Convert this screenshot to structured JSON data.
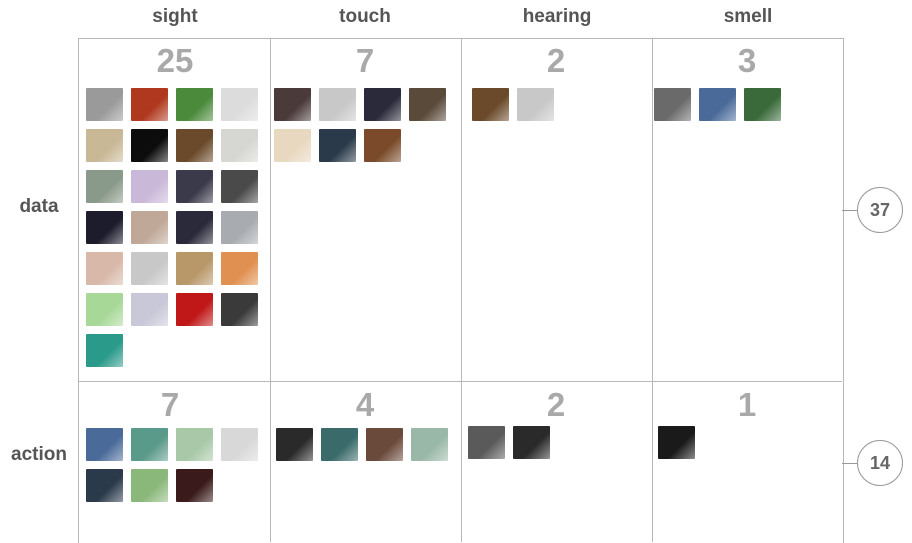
{
  "columns": [
    "sight",
    "touch",
    "hearing",
    "smell"
  ],
  "rows": [
    {
      "label": "data",
      "total": "37",
      "cells": [
        {
          "count": "25",
          "thumbs": [
            "#9a9a9a",
            "#b0381e",
            "#4a8a3a",
            "#dcdcdc",
            "#c9b896",
            "#0c0c0c",
            "#6a4a2a",
            "#d6d6d2",
            "#8a9a8a",
            "#c9b8d8",
            "#3a3a4a",
            "#4a4a4a",
            "#1c1c2c",
            "#c0a898",
            "#2a2a3a",
            "#a8acb0",
            "#d8b8a8",
            "#c8c8c8",
            "#b89868",
            "#e09050",
            "#a8d898",
            "#c8c8d8",
            "#c01818",
            "#3a3a3a",
            "#2a9a8a"
          ]
        },
        {
          "count": "7",
          "thumbs": [
            "#4a3a3a",
            "#c8c8c8",
            "#2a2a3a",
            "#5a4a3a",
            "#e8d8c0",
            "#2a3a4a",
            "#7a4a2a"
          ]
        },
        {
          "count": "2",
          "thumbs": [
            "#6a4a2a",
            "#c8c8c8"
          ]
        },
        {
          "count": "3",
          "thumbs": [
            "#6a6a6a",
            "#4a6a9a",
            "#3a6a3a"
          ]
        }
      ]
    },
    {
      "label": "action",
      "total": "14",
      "cells": [
        {
          "count": "7",
          "thumbs": [
            "#4a6a9a",
            "#5a9a8a",
            "#a8c8a8",
            "#d8d8d8",
            "#2a3a4a",
            "#8ab87a",
            "#3a1a1a"
          ]
        },
        {
          "count": "4",
          "thumbs": [
            "#2a2a2a",
            "#3a6a6a",
            "#6a4a3a",
            "#9ab8a8"
          ]
        },
        {
          "count": "2",
          "thumbs": [
            "#5a5a5a",
            "#2a2a2a"
          ]
        },
        {
          "count": "1",
          "thumbs": [
            "#1a1a1a"
          ]
        }
      ]
    }
  ]
}
